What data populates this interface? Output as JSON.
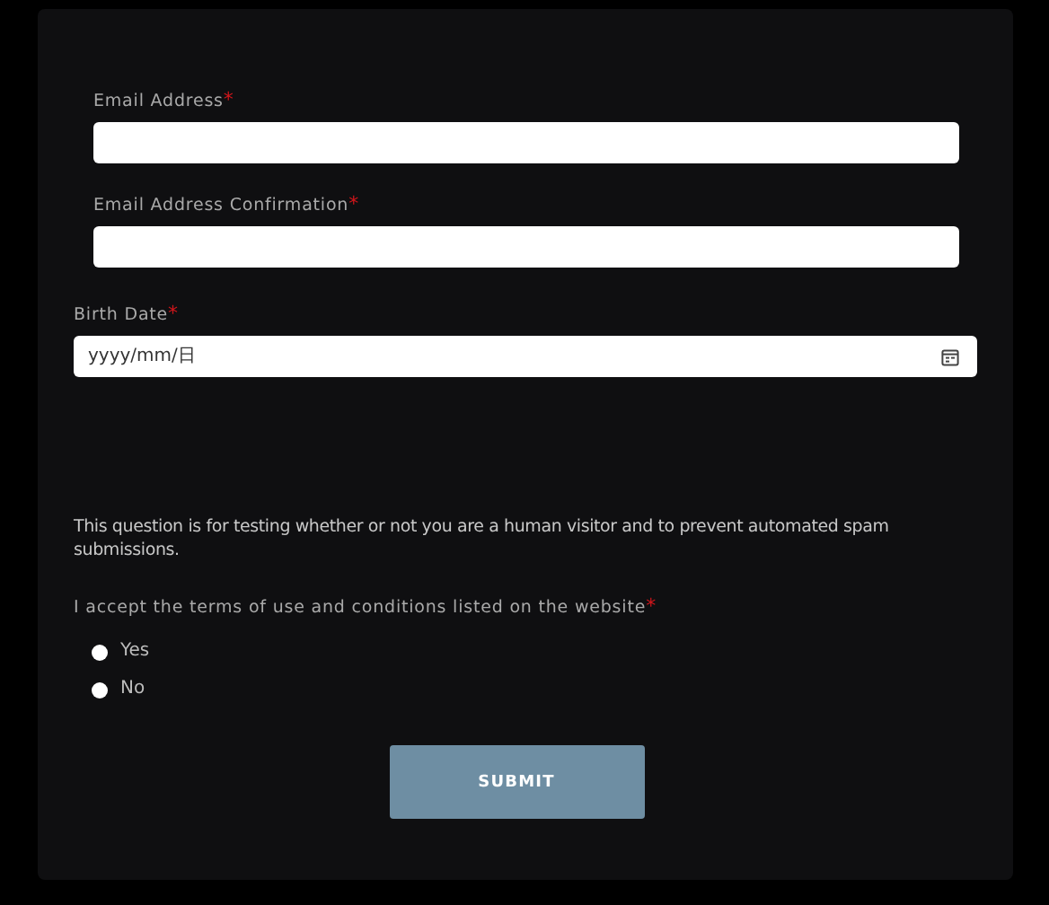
{
  "fields": [
    {
      "label": "Email Address",
      "mark": "*",
      "kind": "text"
    },
    {
      "label": "Email Address Confirmation",
      "mark": "*",
      "kind": "text"
    },
    {
      "label": "Birth Date",
      "mark": "*",
      "kind": "date",
      "placeholder": "yyyy/mm/日"
    }
  ],
  "question": "This question is for testing whether or not you are a human visitor and to prevent automated spam submissions.",
  "terms": {
    "label": "I accept the terms of use and conditions listed on the website",
    "mark": "*"
  },
  "options": [
    {
      "label": "Yes",
      "selected": false
    },
    {
      "label": "No",
      "selected": false
    }
  ],
  "submit": "SUBMIT"
}
